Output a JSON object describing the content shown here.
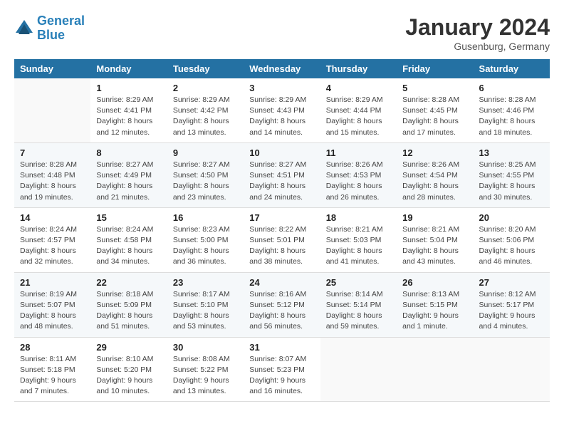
{
  "header": {
    "logo_line1": "General",
    "logo_line2": "Blue",
    "month": "January 2024",
    "location": "Gusenburg, Germany"
  },
  "weekdays": [
    "Sunday",
    "Monday",
    "Tuesday",
    "Wednesday",
    "Thursday",
    "Friday",
    "Saturday"
  ],
  "weeks": [
    [
      null,
      {
        "day": 1,
        "sunrise": "Sunrise: 8:29 AM",
        "sunset": "Sunset: 4:41 PM",
        "daylight": "Daylight: 8 hours and 12 minutes."
      },
      {
        "day": 2,
        "sunrise": "Sunrise: 8:29 AM",
        "sunset": "Sunset: 4:42 PM",
        "daylight": "Daylight: 8 hours and 13 minutes."
      },
      {
        "day": 3,
        "sunrise": "Sunrise: 8:29 AM",
        "sunset": "Sunset: 4:43 PM",
        "daylight": "Daylight: 8 hours and 14 minutes."
      },
      {
        "day": 4,
        "sunrise": "Sunrise: 8:29 AM",
        "sunset": "Sunset: 4:44 PM",
        "daylight": "Daylight: 8 hours and 15 minutes."
      },
      {
        "day": 5,
        "sunrise": "Sunrise: 8:28 AM",
        "sunset": "Sunset: 4:45 PM",
        "daylight": "Daylight: 8 hours and 17 minutes."
      },
      {
        "day": 6,
        "sunrise": "Sunrise: 8:28 AM",
        "sunset": "Sunset: 4:46 PM",
        "daylight": "Daylight: 8 hours and 18 minutes."
      }
    ],
    [
      {
        "day": 7,
        "sunrise": "Sunrise: 8:28 AM",
        "sunset": "Sunset: 4:48 PM",
        "daylight": "Daylight: 8 hours and 19 minutes."
      },
      {
        "day": 8,
        "sunrise": "Sunrise: 8:27 AM",
        "sunset": "Sunset: 4:49 PM",
        "daylight": "Daylight: 8 hours and 21 minutes."
      },
      {
        "day": 9,
        "sunrise": "Sunrise: 8:27 AM",
        "sunset": "Sunset: 4:50 PM",
        "daylight": "Daylight: 8 hours and 23 minutes."
      },
      {
        "day": 10,
        "sunrise": "Sunrise: 8:27 AM",
        "sunset": "Sunset: 4:51 PM",
        "daylight": "Daylight: 8 hours and 24 minutes."
      },
      {
        "day": 11,
        "sunrise": "Sunrise: 8:26 AM",
        "sunset": "Sunset: 4:53 PM",
        "daylight": "Daylight: 8 hours and 26 minutes."
      },
      {
        "day": 12,
        "sunrise": "Sunrise: 8:26 AM",
        "sunset": "Sunset: 4:54 PM",
        "daylight": "Daylight: 8 hours and 28 minutes."
      },
      {
        "day": 13,
        "sunrise": "Sunrise: 8:25 AM",
        "sunset": "Sunset: 4:55 PM",
        "daylight": "Daylight: 8 hours and 30 minutes."
      }
    ],
    [
      {
        "day": 14,
        "sunrise": "Sunrise: 8:24 AM",
        "sunset": "Sunset: 4:57 PM",
        "daylight": "Daylight: 8 hours and 32 minutes."
      },
      {
        "day": 15,
        "sunrise": "Sunrise: 8:24 AM",
        "sunset": "Sunset: 4:58 PM",
        "daylight": "Daylight: 8 hours and 34 minutes."
      },
      {
        "day": 16,
        "sunrise": "Sunrise: 8:23 AM",
        "sunset": "Sunset: 5:00 PM",
        "daylight": "Daylight: 8 hours and 36 minutes."
      },
      {
        "day": 17,
        "sunrise": "Sunrise: 8:22 AM",
        "sunset": "Sunset: 5:01 PM",
        "daylight": "Daylight: 8 hours and 38 minutes."
      },
      {
        "day": 18,
        "sunrise": "Sunrise: 8:21 AM",
        "sunset": "Sunset: 5:03 PM",
        "daylight": "Daylight: 8 hours and 41 minutes."
      },
      {
        "day": 19,
        "sunrise": "Sunrise: 8:21 AM",
        "sunset": "Sunset: 5:04 PM",
        "daylight": "Daylight: 8 hours and 43 minutes."
      },
      {
        "day": 20,
        "sunrise": "Sunrise: 8:20 AM",
        "sunset": "Sunset: 5:06 PM",
        "daylight": "Daylight: 8 hours and 46 minutes."
      }
    ],
    [
      {
        "day": 21,
        "sunrise": "Sunrise: 8:19 AM",
        "sunset": "Sunset: 5:07 PM",
        "daylight": "Daylight: 8 hours and 48 minutes."
      },
      {
        "day": 22,
        "sunrise": "Sunrise: 8:18 AM",
        "sunset": "Sunset: 5:09 PM",
        "daylight": "Daylight: 8 hours and 51 minutes."
      },
      {
        "day": 23,
        "sunrise": "Sunrise: 8:17 AM",
        "sunset": "Sunset: 5:10 PM",
        "daylight": "Daylight: 8 hours and 53 minutes."
      },
      {
        "day": 24,
        "sunrise": "Sunrise: 8:16 AM",
        "sunset": "Sunset: 5:12 PM",
        "daylight": "Daylight: 8 hours and 56 minutes."
      },
      {
        "day": 25,
        "sunrise": "Sunrise: 8:14 AM",
        "sunset": "Sunset: 5:14 PM",
        "daylight": "Daylight: 8 hours and 59 minutes."
      },
      {
        "day": 26,
        "sunrise": "Sunrise: 8:13 AM",
        "sunset": "Sunset: 5:15 PM",
        "daylight": "Daylight: 9 hours and 1 minute."
      },
      {
        "day": 27,
        "sunrise": "Sunrise: 8:12 AM",
        "sunset": "Sunset: 5:17 PM",
        "daylight": "Daylight: 9 hours and 4 minutes."
      }
    ],
    [
      {
        "day": 28,
        "sunrise": "Sunrise: 8:11 AM",
        "sunset": "Sunset: 5:18 PM",
        "daylight": "Daylight: 9 hours and 7 minutes."
      },
      {
        "day": 29,
        "sunrise": "Sunrise: 8:10 AM",
        "sunset": "Sunset: 5:20 PM",
        "daylight": "Daylight: 9 hours and 10 minutes."
      },
      {
        "day": 30,
        "sunrise": "Sunrise: 8:08 AM",
        "sunset": "Sunset: 5:22 PM",
        "daylight": "Daylight: 9 hours and 13 minutes."
      },
      {
        "day": 31,
        "sunrise": "Sunrise: 8:07 AM",
        "sunset": "Sunset: 5:23 PM",
        "daylight": "Daylight: 9 hours and 16 minutes."
      },
      null,
      null,
      null
    ]
  ]
}
